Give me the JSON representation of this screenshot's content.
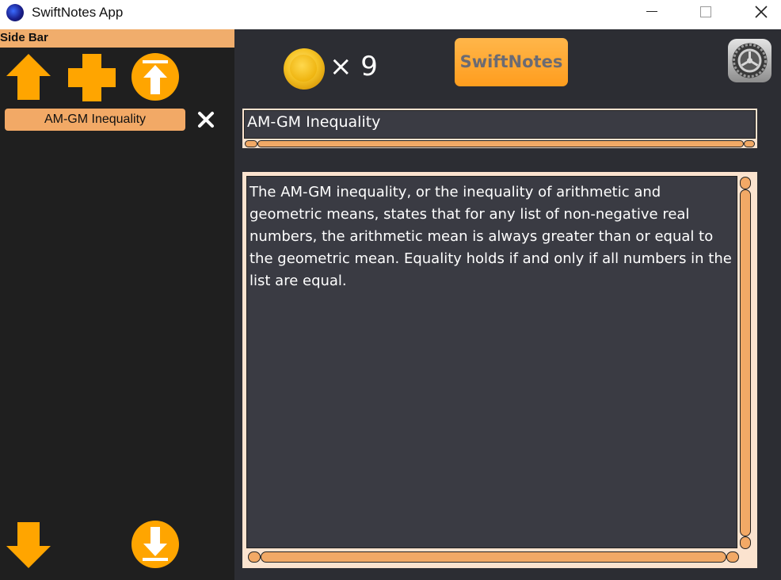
{
  "window": {
    "title": "SwiftNotes App"
  },
  "sidebar": {
    "header": "Side Bar",
    "notes": [
      {
        "label": "AM-GM Inequality"
      }
    ]
  },
  "toolbar": {
    "coin_count": "× 9",
    "logo_text": "SwiftNotes"
  },
  "editor": {
    "title": "AM-GM Inequality",
    "body": "The AM-GM inequality, or the inequality of arithmetic and geometric means, states that for any list of non-negative real numbers, the arithmetic mean is always greater than or equal to the geometric mean. Equality holds if and only if all numbers in the list are equal."
  },
  "colors": {
    "accent": "#f2a966",
    "button": "#ffa500",
    "background": "#2c2d33",
    "sidebar": "#1f1f1f"
  },
  "icons": [
    "app-icon",
    "minimize-icon",
    "maximize-icon",
    "close-icon",
    "arrow-up-icon",
    "plus-icon",
    "arrow-to-top-icon",
    "delete-x-icon",
    "arrow-down-icon",
    "arrow-to-bottom-icon",
    "coin-icon",
    "settings-gear-icon"
  ]
}
